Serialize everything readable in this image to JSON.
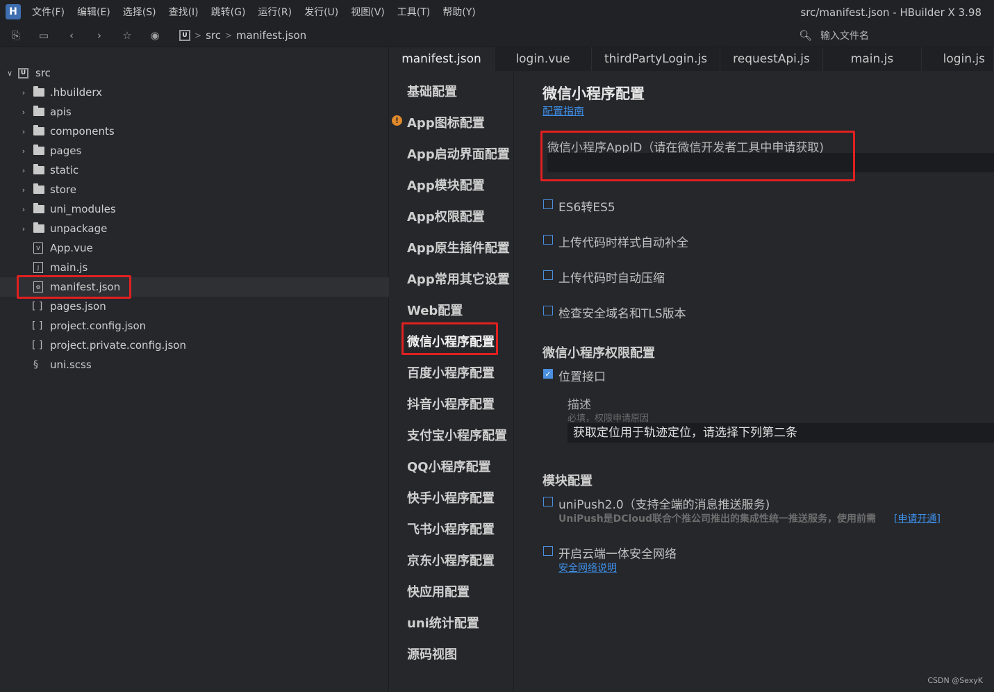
{
  "menubar": {
    "logo": "H",
    "items": [
      "文件(F)",
      "编辑(E)",
      "选择(S)",
      "查找(I)",
      "跳转(G)",
      "运行(R)",
      "发行(U)",
      "视图(V)",
      "工具(T)",
      "帮助(Y)"
    ],
    "window_title": "src/manifest.json - HBuilder X 3.98"
  },
  "toolbar": {
    "breadcrumb": [
      "src",
      "manifest.json"
    ],
    "breadcrumb_sep": ">",
    "crumb_logo": "U",
    "search_placeholder": "输入文件名"
  },
  "sidebar": {
    "root": "src",
    "items": [
      {
        "label": ".hbuilderx",
        "type": "folder"
      },
      {
        "label": "apis",
        "type": "folder"
      },
      {
        "label": "components",
        "type": "folder"
      },
      {
        "label": "pages",
        "type": "folder"
      },
      {
        "label": "static",
        "type": "folder"
      },
      {
        "label": "store",
        "type": "folder"
      },
      {
        "label": "uni_modules",
        "type": "folder"
      },
      {
        "label": "unpackage",
        "type": "folder"
      },
      {
        "label": "App.vue",
        "type": "vue"
      },
      {
        "label": "main.js",
        "type": "js"
      },
      {
        "label": "manifest.json",
        "type": "manifest"
      },
      {
        "label": "pages.json",
        "type": "json"
      },
      {
        "label": "project.config.json",
        "type": "json"
      },
      {
        "label": "project.private.config.json",
        "type": "json"
      },
      {
        "label": "uni.scss",
        "type": "scss"
      }
    ]
  },
  "tabs": [
    "manifest.json",
    "login.vue",
    "thirdPartyLogin.js",
    "requestApi.js",
    "main.js",
    "login.js"
  ],
  "settings_nav": [
    "基础配置",
    "App图标配置",
    "App启动界面配置",
    "App模块配置",
    "App权限配置",
    "App原生插件配置",
    "App常用其它设置",
    "Web配置",
    "微信小程序配置",
    "百度小程序配置",
    "抖音小程序配置",
    "支付宝小程序配置",
    "QQ小程序配置",
    "快手小程序配置",
    "飞书小程序配置",
    "京东小程序配置",
    "快应用配置",
    "uni统计配置",
    "源码视图"
  ],
  "warning_mark": "!",
  "content": {
    "title": "微信小程序配置",
    "guide_link": "配置指南",
    "appid_label": "微信小程序AppID（请在微信开发者工具中申请获取)",
    "appid_value": "",
    "checkboxes": [
      {
        "label": "ES6转ES5",
        "checked": false
      },
      {
        "label": "上传代码时样式自动补全",
        "checked": false
      },
      {
        "label": "上传代码时自动压缩",
        "checked": false
      },
      {
        "label": "检查安全域名和TLS版本",
        "checked": false
      }
    ],
    "permission_title": "微信小程序权限配置",
    "location_label": "位置接口",
    "location_checked": true,
    "check_mark": "✓",
    "desc_label": "描述",
    "desc_hint": "必填，权限申请原因",
    "desc_value": "获取定位用于轨迹定位，请选择下列第二条",
    "module_title": "模块配置",
    "unipush_label": "uniPush2.0（支持全端的消息推送服务)",
    "unipush_desc": "UniPush是DCloud联合个推公司推出的集成性统一推送服务，使用前需",
    "unipush_link": "[申请开通]",
    "cloud_label": "开启云端一体安全网络",
    "cloud_link": "安全网络说明"
  },
  "watermark": "CSDN @SexyK",
  "colors": {
    "highlight_box": "#e02020",
    "link": "#3d8fe8",
    "accent": "#4a8fe0"
  }
}
